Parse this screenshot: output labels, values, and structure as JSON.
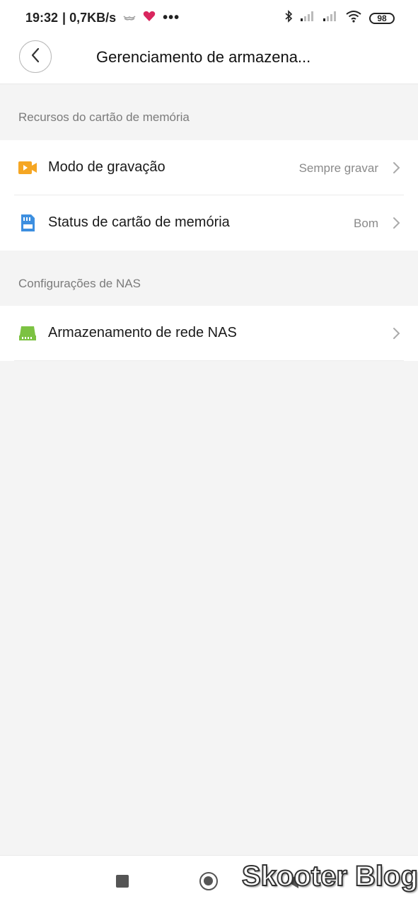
{
  "status_bar": {
    "time": "19:32",
    "net_speed": "| 0,7KB/s",
    "more": "•••",
    "battery": "98",
    "icons": [
      "hands-icon",
      "heart-icon",
      "bluetooth-icon",
      "signal-icon",
      "signal-icon",
      "wifi-icon",
      "battery-icon"
    ]
  },
  "header": {
    "title": "Gerenciamento de armazena..."
  },
  "sections": [
    {
      "label": "Recursos do cartão de memória",
      "items": [
        {
          "label": "Modo de gravação",
          "value": "Sempre gravar",
          "icon": "video-camera-icon",
          "icon_color": "#f5a623"
        },
        {
          "label": "Status de cartão de memória",
          "value": "Bom",
          "icon": "sd-card-icon",
          "icon_color": "#3d8fe0"
        }
      ]
    },
    {
      "label": "Configurações de NAS",
      "items": [
        {
          "label": "Armazenamento de rede NAS",
          "value": "",
          "icon": "nas-drive-icon",
          "icon_color": "#7cc242"
        }
      ]
    }
  ],
  "watermark": "Skooter Blog",
  "colors": {
    "background": "#f4f4f4",
    "surface": "#ffffff",
    "secondary_text": "#8a8a8a"
  }
}
